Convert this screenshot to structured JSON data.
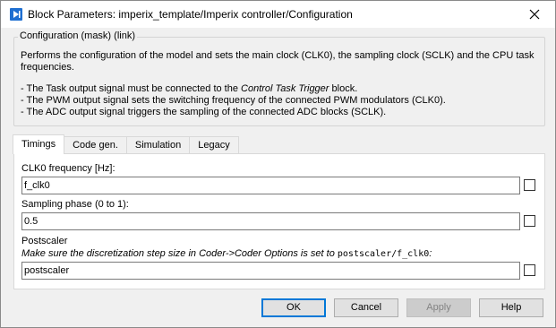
{
  "window": {
    "title": "Block Parameters: imperix_template/Imperix controller/Configuration"
  },
  "mask": {
    "legend": "Configuration (mask) (link)",
    "description_lines": [
      "Performs the configuration of the model and sets the main clock (CLK0), the sampling clock (SCLK) and the CPU task",
      "frequencies."
    ],
    "bullets": [
      {
        "prefix": "- The Task output signal must be connected to the ",
        "italic": "Control Task Trigger",
        "suffix": " block."
      },
      {
        "text": "- The PWM output signal sets the switching frequency of the connected PWM modulators (CLK0)."
      },
      {
        "text": "- The ADC output signal triggers the sampling of the connected ADC blocks (SCLK)."
      }
    ]
  },
  "tabs": [
    {
      "label": "Timings",
      "active": true
    },
    {
      "label": "Code gen.",
      "active": false
    },
    {
      "label": "Simulation",
      "active": false
    },
    {
      "label": "Legacy",
      "active": false
    }
  ],
  "params": {
    "clk0": {
      "label": "CLK0 frequency [Hz]:",
      "value": "f_clk0"
    },
    "sampling": {
      "label": "Sampling phase (0 to 1):",
      "value": "0.5"
    },
    "postscaler": {
      "label": "Postscaler",
      "note_prefix": "Make sure the discretization step size in Coder->Coder Options is set to ",
      "note_code": "postscaler/f_clk0",
      "note_suffix": ":",
      "value": "postscaler"
    }
  },
  "buttons": {
    "ok": "OK",
    "cancel": "Cancel",
    "apply": "Apply",
    "help": "Help"
  },
  "icons": {
    "app": "simulink-block-icon",
    "close": "close-icon"
  }
}
